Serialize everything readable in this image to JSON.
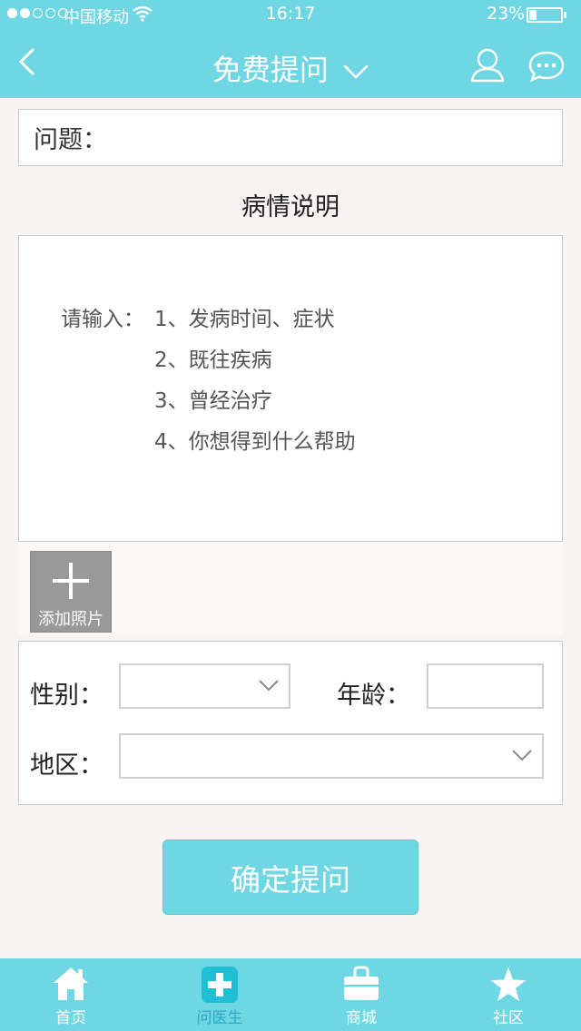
{
  "status_bar": {
    "carrier": "中国移动",
    "time": "16:17",
    "battery_percent": "23%",
    "battery_level": 0.23,
    "signal_bars": 2
  },
  "nav": {
    "title": "免费提问"
  },
  "question": {
    "label": "问题：",
    "value": "",
    "placeholder": ""
  },
  "description": {
    "section_title": "病情说明",
    "hint_prefix": "请输入：",
    "hint_lines": [
      "1、发病时间、症状",
      "2、既往疾病",
      "3、曾经治疗",
      "4、你想得到什么帮助"
    ]
  },
  "photo": {
    "add_label": "添加照片"
  },
  "info": {
    "gender_label": "性别：",
    "gender_value": "",
    "age_label": "年龄：",
    "age_value": "",
    "region_label": "地区：",
    "region_value": ""
  },
  "submit": {
    "label": "确定提问"
  },
  "tabbar": {
    "tabs": [
      {
        "label": "首页",
        "icon": "home-icon"
      },
      {
        "label": "问医生",
        "icon": "medical-cross-icon"
      },
      {
        "label": "商城",
        "icon": "shopping-bag-icon"
      },
      {
        "label": "社区",
        "icon": "star-icon"
      }
    ],
    "active_index": 1
  },
  "colors": {
    "primary": "#6fd6e3",
    "active_tab_text": "#2fa9c2",
    "active_tab_icon": "#1fbfd6"
  }
}
